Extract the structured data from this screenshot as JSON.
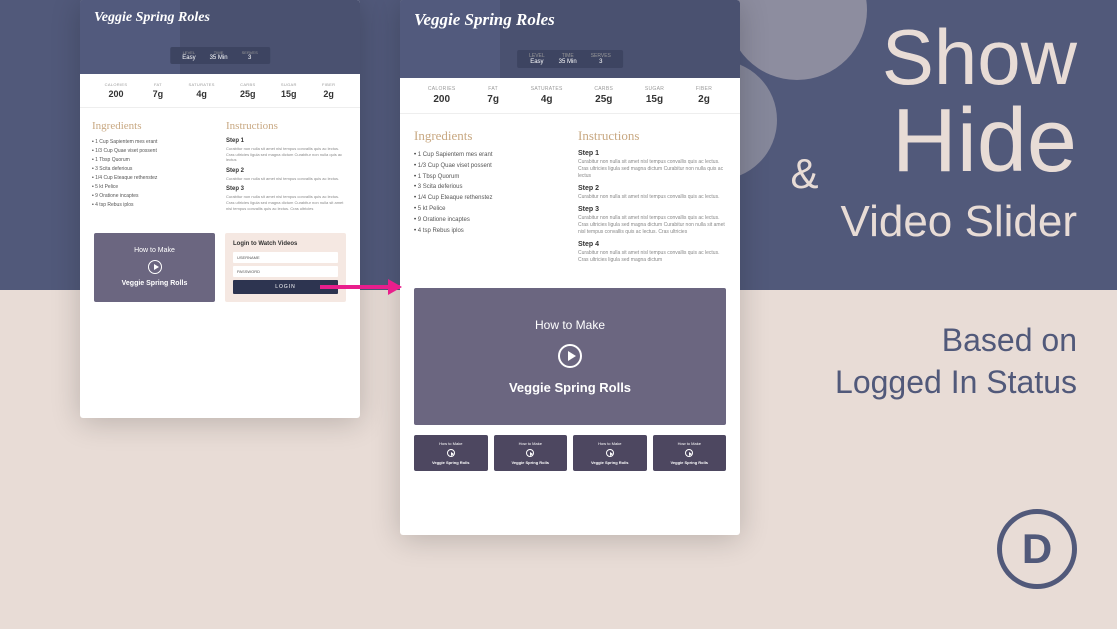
{
  "headline": {
    "l1": "Show",
    "amp": "&",
    "l2": "Hide",
    "l3": "Video Slider"
  },
  "sub": {
    "l1": "Based on",
    "l2": "Logged In Status"
  },
  "logo": "D",
  "recipe": {
    "title": "Veggie Spring Roles",
    "meta": [
      {
        "l": "LEVEL",
        "v": "Easy"
      },
      {
        "l": "TIME",
        "v": "35 Min"
      },
      {
        "l": "SERVES",
        "v": "3"
      }
    ],
    "nutrition": [
      {
        "l": "CALORIES",
        "v": "200"
      },
      {
        "l": "FAT",
        "v": "7g"
      },
      {
        "l": "SATURATES",
        "v": "4g"
      },
      {
        "l": "CARBS",
        "v": "25g"
      },
      {
        "l": "SUGAR",
        "v": "15g"
      },
      {
        "l": "FIBER",
        "v": "2g"
      }
    ],
    "ing_h": "Ingredients",
    "ins_h": "Instructions",
    "ingredients": [
      "1 Cup Sapientem mes erant",
      "1/3 Cup Quae viset possent",
      "1 Tbsp Quorum",
      "3 Scita deferious",
      "1/4 Cup Eteaque rethenstez",
      "5 kt Pelice",
      "9 Oratione incaptes",
      "4 tsp Rebus iplos"
    ],
    "steps": [
      {
        "t": "Step 1",
        "b": "Curabitur non nulla sit amet nisl tempus convallis quis ac lectus. Cras ultricies ligula sed magna dictum Curabitur non nulla quis ac lectus"
      },
      {
        "t": "Step 2",
        "b": "Curabitur non nulla sit amet nisl tempus convallis quis ac lectus."
      },
      {
        "t": "Step 3",
        "b": "Curabitur non nulla sit amet nisl tempus convallis quis ac lectus. Cras ultricies ligula sed magna dictum Curabitur non nulla sit amet nisl tempus convallis quis ac lectus. Cras ultricies"
      },
      {
        "t": "Step 4",
        "b": "Curabitur non nulla sit amet nisl tempus convallis quis ac lectus. Cras ultricies ligula sed magna dictum"
      }
    ]
  },
  "video": {
    "top": "How to Make",
    "bottom": "Veggie Spring Rolls"
  },
  "login": {
    "h": "Login to Watch Videos",
    "u": "USERNAME",
    "p": "PASSWORD",
    "btn": "LOGIN"
  }
}
